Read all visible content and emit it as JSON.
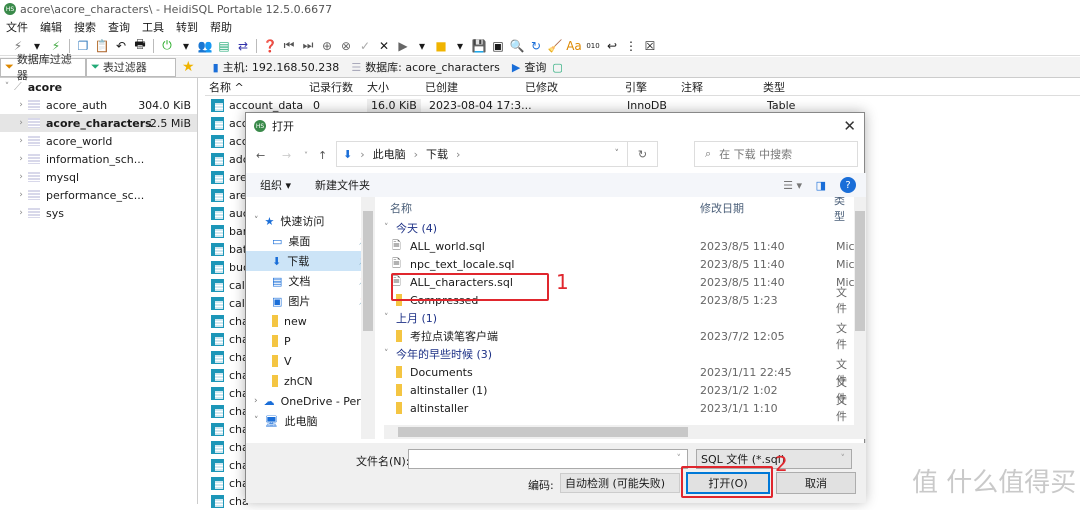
{
  "window": {
    "title": "acore\\acore_characters\\ - HeidiSQL Portable 12.5.0.6677"
  },
  "menu": [
    "文件",
    "编辑",
    "搜索",
    "查询",
    "工具",
    "转到",
    "帮助"
  ],
  "filters": {
    "db_filter": "数据库过滤器",
    "table_filter": "表过滤器"
  },
  "breadcrumb": {
    "host": "主机: 192.168.50.238",
    "database": "数据库: acore_characters",
    "query": "查询"
  },
  "tree": {
    "root": "acore",
    "items": [
      {
        "name": "acore_auth",
        "size": "304.0 KiB"
      },
      {
        "name": "acore_characters",
        "size": "2.5 MiB"
      },
      {
        "name": "acore_world",
        "size": ""
      },
      {
        "name": "information_sch...",
        "size": ""
      },
      {
        "name": "mysql",
        "size": ""
      },
      {
        "name": "performance_sc...",
        "size": ""
      },
      {
        "name": "sys",
        "size": ""
      }
    ]
  },
  "table": {
    "headers": [
      "名称 ^",
      "记录行数",
      "大小",
      "已创建",
      "已修改",
      "引擎",
      "注释",
      "类型"
    ],
    "first_row": {
      "name": "account_data",
      "rows": "0",
      "size": "16.0 KiB",
      "created": "2023-08-04 17:3...",
      "modified": "",
      "engine": "InnoDB",
      "comment": "",
      "type": "Table"
    },
    "partial_names": [
      "acc",
      "acc",
      "adc",
      "are",
      "are",
      "auc",
      "bar",
      "bat",
      "buc",
      "cal",
      "cal",
      "cha",
      "cha",
      "cha",
      "cha",
      "cha",
      "cha",
      "cha",
      "cha",
      "cha",
      "cha",
      "cha"
    ]
  },
  "dialog": {
    "title": "打开",
    "path": [
      "此电脑",
      "下载"
    ],
    "search_placeholder": "在 下载 中搜索",
    "organize": "组织 ▾",
    "new_folder": "新建文件夹",
    "nav_items": [
      {
        "label": "快速访问",
        "pin": false
      },
      {
        "label": "桌面",
        "pin": true
      },
      {
        "label": "下载",
        "pin": true
      },
      {
        "label": "文档",
        "pin": true
      },
      {
        "label": "图片",
        "pin": true
      },
      {
        "label": "new"
      },
      {
        "label": "P"
      },
      {
        "label": "V"
      },
      {
        "label": "zhCN"
      },
      {
        "label": "OneDrive - Perso"
      },
      {
        "label": "此电脑"
      }
    ],
    "columns": [
      "名称",
      "修改日期",
      "类型"
    ],
    "groups": [
      {
        "label": "今天 (4)",
        "files": [
          {
            "name": "ALL_world.sql",
            "date": "2023/8/5 11:40",
            "type": "Mic",
            "kind": "file"
          },
          {
            "name": "npc_text_locale.sql",
            "date": "2023/8/5 11:40",
            "type": "Mic",
            "kind": "file"
          },
          {
            "name": "ALL_characters.sql",
            "date": "2023/8/5 11:40",
            "type": "Mic",
            "kind": "file"
          },
          {
            "name": "Compressed",
            "date": "2023/8/5 1:23",
            "type": "文件",
            "kind": "folder"
          }
        ]
      },
      {
        "label": "上月 (1)",
        "files": [
          {
            "name": "考拉点读笔客户端",
            "date": "2023/7/2 12:05",
            "type": "文件",
            "kind": "folder"
          }
        ]
      },
      {
        "label": "今年的早些时候 (3)",
        "files": [
          {
            "name": "Documents",
            "date": "2023/1/11 22:45",
            "type": "文件",
            "kind": "folder"
          },
          {
            "name": "altinstaller (1)",
            "date": "2023/1/2 1:02",
            "type": "文件",
            "kind": "folder"
          },
          {
            "name": "altinstaller",
            "date": "2023/1/1 1:10",
            "type": "文件",
            "kind": "folder"
          }
        ]
      }
    ],
    "filename_label": "文件名(N):",
    "filename_value": "",
    "filetype": "SQL 文件 (*.sql)",
    "encoding_label": "编码:",
    "encoding": "自动检测 (可能失败)",
    "open": "打开(O)",
    "cancel": "取消"
  },
  "annotations": {
    "step1": "1",
    "step2": "2",
    "color": "#e0262d"
  },
  "watermark": "值 什么值得买"
}
